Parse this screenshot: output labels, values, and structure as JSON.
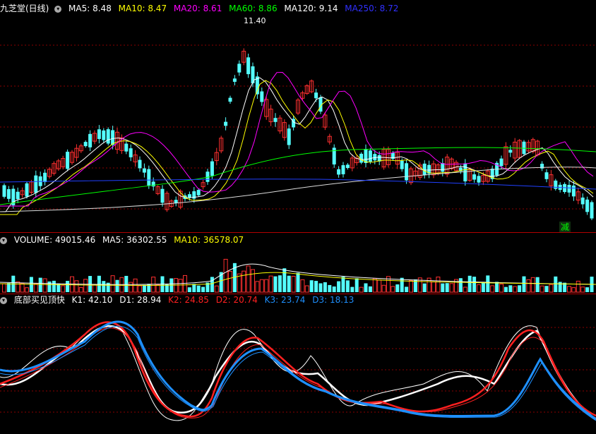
{
  "price_panel": {
    "stock_title": "九芝堂(日线)",
    "ma": [
      {
        "label": "MA5:",
        "value": "8.48",
        "color": "#ffffff"
      },
      {
        "label": "MA10:",
        "value": "8.47",
        "color": "#ffff00"
      },
      {
        "label": "MA20:",
        "value": "8.61",
        "color": "#ff00ff"
      },
      {
        "label": "MA60:",
        "value": "8.86",
        "color": "#00ff00"
      },
      {
        "label": "MA120:",
        "value": "9.14",
        "color": "#ffffff"
      },
      {
        "label": "MA250:",
        "value": "8.72",
        "color": "#0000ff"
      }
    ],
    "high_label": "11.40",
    "signal_text": "减"
  },
  "volume_panel": {
    "title": "VOLUME:",
    "value": "49015.46",
    "ma5_label": "MA5:",
    "ma5": "36302.55",
    "ma10_label": "MA10:",
    "ma10": "36578.07"
  },
  "indicator_panel": {
    "name": "底部买见顶快",
    "lines": [
      {
        "label": "K1:",
        "value": "42.10",
        "color": "#ffffff"
      },
      {
        "label": "D1:",
        "value": "28.94",
        "color": "#ffffff"
      },
      {
        "label": "K2:",
        "value": "24.85",
        "color": "#ff2020"
      },
      {
        "label": "D2:",
        "value": "20.74",
        "color": "#ff2020"
      },
      {
        "label": "K3:",
        "value": "23.74",
        "color": "#1e90ff"
      },
      {
        "label": "D3:",
        "value": "18.13",
        "color": "#1e90ff"
      }
    ]
  },
  "colors": {
    "up": "#ff3030",
    "down": "#54ffff",
    "grid": "#8b0000",
    "bg": "#000000"
  },
  "icons": [
    "settings-circle-icon"
  ]
}
